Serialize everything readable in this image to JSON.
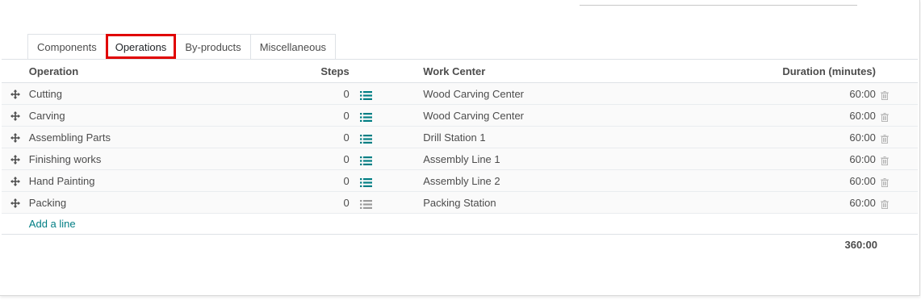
{
  "tabs": [
    {
      "label": "Components"
    },
    {
      "label": "Operations"
    },
    {
      "label": "By-products"
    },
    {
      "label": "Miscellaneous"
    }
  ],
  "columns": {
    "operation": "Operation",
    "steps": "Steps",
    "work_center": "Work Center",
    "duration": "Duration (minutes)"
  },
  "rows": [
    {
      "operation": "Cutting",
      "steps": "0",
      "work_center": "Wood Carving Center",
      "duration": "60:00"
    },
    {
      "operation": "Carving",
      "steps": "0",
      "work_center": "Wood Carving Center",
      "duration": "60:00"
    },
    {
      "operation": "Assembling Parts",
      "steps": "0",
      "work_center": "Drill Station 1",
      "duration": "60:00"
    },
    {
      "operation": "Finishing works",
      "steps": "0",
      "work_center": "Assembly Line 1",
      "duration": "60:00"
    },
    {
      "operation": "Hand Painting",
      "steps": "0",
      "work_center": "Assembly Line 2",
      "duration": "60:00"
    },
    {
      "operation": "Packing",
      "steps": "0",
      "work_center": "Packing Station",
      "duration": "60:00"
    }
  ],
  "add_line": "Add a line",
  "total_duration": "360:00",
  "colors": {
    "accent": "#017e84",
    "highlight": "#e00000",
    "steps_icon_active": "#017e84",
    "steps_icon_inactive": "#9a9a9a"
  }
}
